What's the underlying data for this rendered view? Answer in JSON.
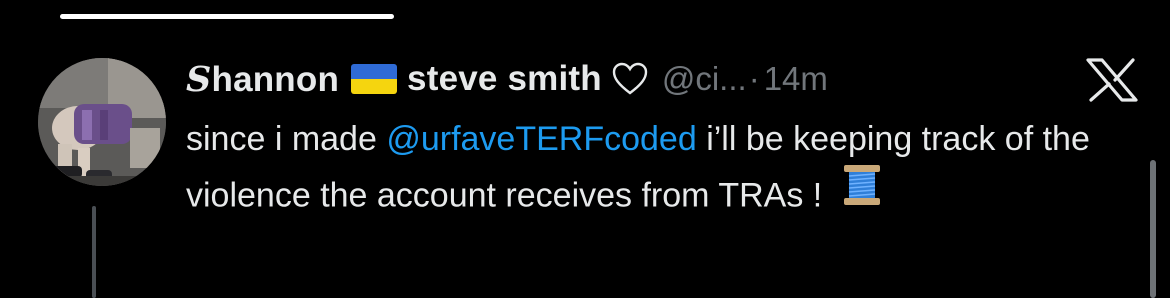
{
  "tweet": {
    "display_name_first_letter": "S",
    "display_name_rest": "hannon",
    "display_name_suffix": "steve smith",
    "handle": "@ci...",
    "separator": "·",
    "time": "14m",
    "text_before_mention": "since i made ",
    "mention": "@urfaveTERFcoded",
    "text_after_mention": " i’ll be keeping track of the violence the account receives from TRAs ! ",
    "flag_icon": "ukraine-flag-emoji",
    "heart_icon": "white-heart-emoji",
    "spool_icon": "thread-spool-emoji"
  },
  "colors": {
    "background": "#000000",
    "text": "#e7e9ea",
    "secondary_text": "#71767b",
    "link": "#1d9bf0"
  }
}
